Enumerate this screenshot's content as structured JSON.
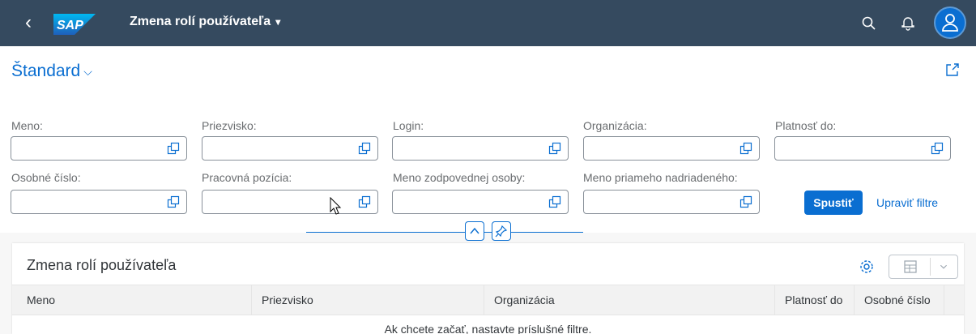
{
  "shell": {
    "title": "Zmena rolí používateľa",
    "title_caret": "▾",
    "back_glyph": "‹",
    "logo_text": "SAP",
    "icons": {
      "back": "back-icon",
      "search": "search-icon",
      "notifications": "bell-icon",
      "user": "user-icon"
    }
  },
  "variant": {
    "label": "Štandard",
    "chevron": "⌵"
  },
  "filters": {
    "meno": "Meno:",
    "priezvisko": "Priezvisko:",
    "login": "Login:",
    "organizacia": "Organizácia:",
    "platnost_do": "Platnosť do:",
    "osobne_cislo": "Osobné číslo:",
    "pracovna_pozicia": "Pracovná pozícia:",
    "meno_zodpovednej": "Meno zodpovednej osoby:",
    "meno_nadriadeneho": "Meno priameho nadriadeného:"
  },
  "actions": {
    "go": "Spustiť",
    "adapt": "Upraviť filtre"
  },
  "table": {
    "title": "Zmena rolí používateľa",
    "columns": [
      "Meno",
      "Priezvisko",
      "Organizácia",
      "Platnosť do",
      "Osobné číslo"
    ],
    "no_data": "Ak chcete začať, nastavte príslušné filtre."
  },
  "colors": {
    "shell": "#354a5f",
    "accent": "#0a6ed1",
    "avatar": "#0a6ed1"
  }
}
